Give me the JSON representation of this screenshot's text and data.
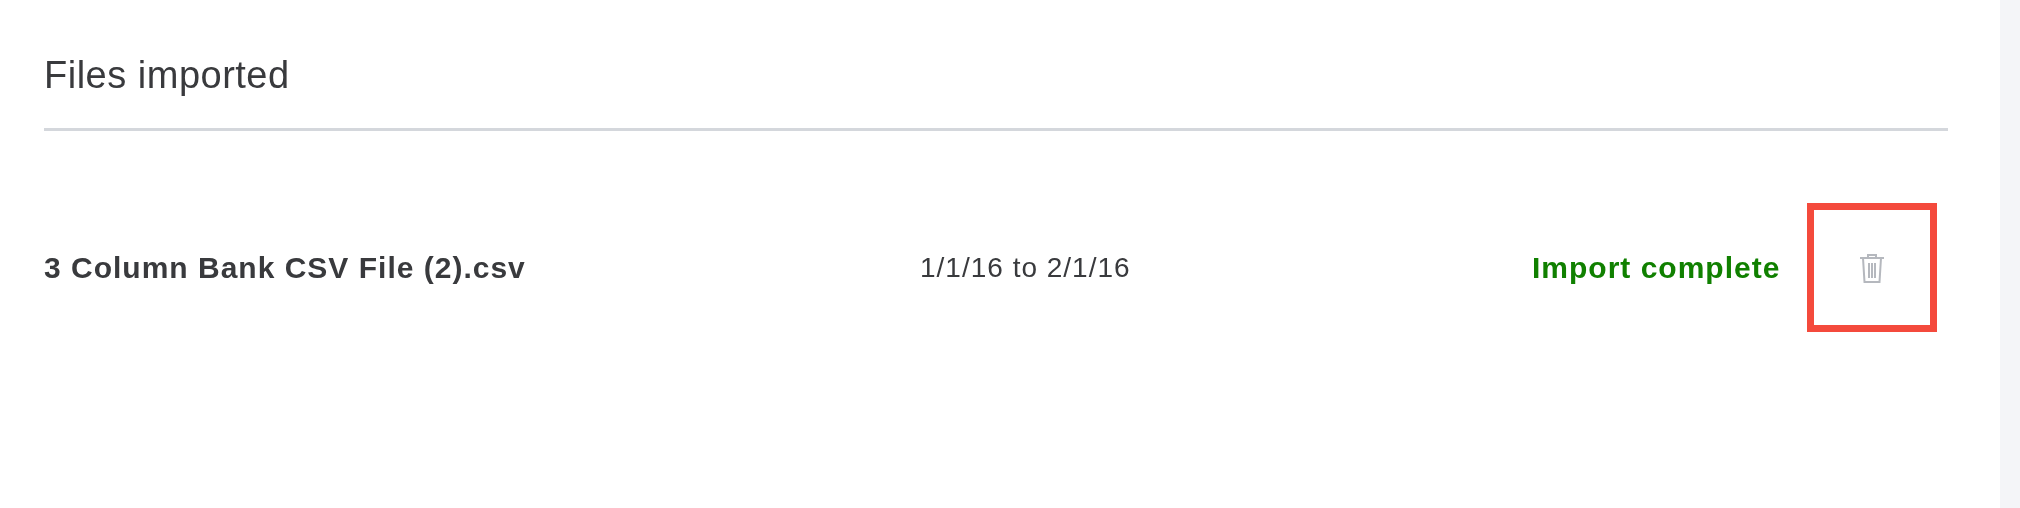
{
  "section": {
    "title": "Files imported"
  },
  "files": [
    {
      "name": "3 Column Bank CSV File (2).csv",
      "date_range": "1/1/16 to 2/1/16",
      "status": "Import complete",
      "delete_highlighted": true
    }
  ]
}
